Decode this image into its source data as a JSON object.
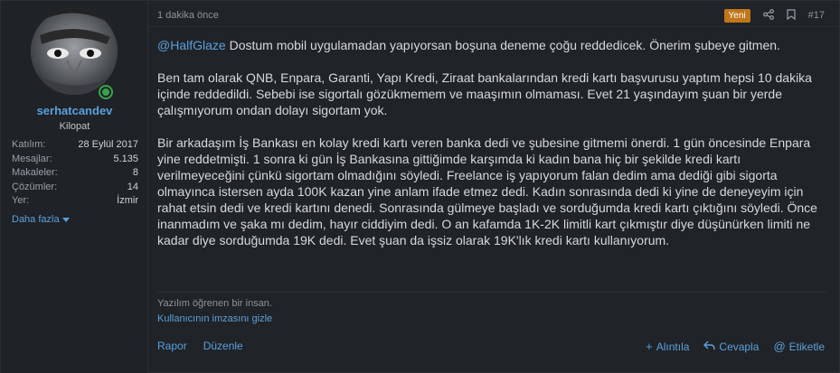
{
  "user": {
    "username": "serhatcandev",
    "title": "Kilopat",
    "more_label": "Daha fazla",
    "stats": [
      {
        "key": "Katılım:",
        "value": "28 Eylül 2017"
      },
      {
        "key": "Mesajlar:",
        "value": "5.135"
      },
      {
        "key": "Makaleler:",
        "value": "8"
      },
      {
        "key": "Çözümler:",
        "value": "14"
      },
      {
        "key": "Yer:",
        "value": "İzmir"
      }
    ]
  },
  "post": {
    "time": "1 dakika önce",
    "new_badge": "Yeni",
    "number": "#17",
    "mention": "@HalfGlaze",
    "paragraph_1_rest": " Dostum mobil uygulamadan yapıyorsan boşuna deneme çoğu reddedicek. Önerim şubeye gitmen.",
    "paragraph_2": "Ben tam olarak QNB, Enpara, Garanti, Yapı Kredi, Ziraat bankalarından kredi kartı başvurusu yaptım hepsi 10 dakika içinde reddedildi. Sebebi ise sigortalı gözükmemem ve maaşımın olmaması. Evet 21 yaşındayım şuan bir yerde çalışmıyorum ondan dolayı sigortam yok.",
    "paragraph_3": "Bir arkadaşım İş Bankası en kolay kredi kartı veren banka dedi ve şubesine gitmemi önerdi. 1 gün öncesinde Enpara yine reddetmişti. 1 sonra ki gün İş Bankasına gittiğimde karşımda ki kadın bana hiç bir şekilde kredi kartı verilmeyeceğini çünkü sigortam olmadığını söyledi. Freelance iş yapıyorum falan dedim ama dediği gibi sigorta olmayınca istersen ayda 100K kazan yine anlam ifade etmez dedi. Kadın sonrasında dedi ki yine de deneyeyim için rahat etsin dedi ve kredi kartını denedi. Sonrasında gülmeye başladı ve sorduğumda kredi kartı çıktığını söyledi. Önce inanmadım ve şaka mı dedim, hayır ciddiyim dedi. O an kafamda 1K-2K limitli kart çıkmıştır diye düşünürken limiti ne kadar diye sorduğumda 19K dedi. Evet şuan da işsiz olarak 19K'lık kredi kartı kullanıyorum.",
    "signature": "Yazılım öğrenen bir insan.",
    "hide_signature": "Kullanıcının imzasını gizle"
  },
  "actions": {
    "report": "Rapor",
    "edit": "Düzenle",
    "quote": "Alıntıla",
    "reply": "Cevapla",
    "tag": "Etiketle"
  },
  "colors": {
    "accent": "#5aa0dd",
    "new_badge": "#c0761a",
    "online": "#3aa34a"
  }
}
